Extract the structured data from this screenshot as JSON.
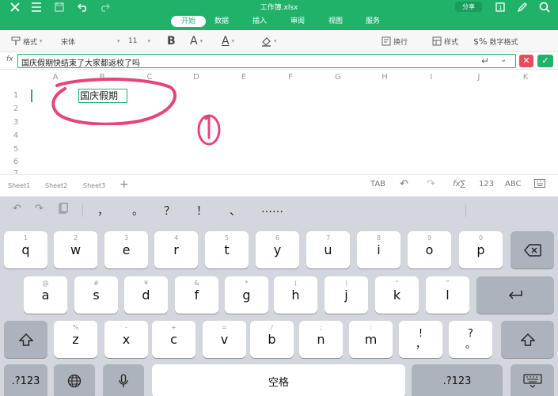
{
  "header": {
    "title": "工作簿.xlsx",
    "share_label": "分享",
    "tabs": [
      "开始",
      "数据",
      "插入",
      "审阅",
      "视图",
      "服务"
    ],
    "active_tab": 0
  },
  "toolbar": {
    "format_label": "格式",
    "font_name": "宋体",
    "font_size": "11",
    "bold_label": "B",
    "font_color_label": "A",
    "text_color_label": "A",
    "wrap_label": "换行",
    "style_label": "样式",
    "number_format_label": "数字格式"
  },
  "formula_bar": {
    "fx_label": "fx",
    "value": "国庆假期快结束了大家都返校了吗",
    "cancel_label": "✕",
    "confirm_label": "✓"
  },
  "grid": {
    "columns": [
      "A",
      "B",
      "C",
      "D",
      "E",
      "F",
      "G",
      "H",
      "I",
      "J",
      "K"
    ],
    "rows": [
      "1",
      "2",
      "3",
      "4",
      "5",
      "6",
      "7"
    ],
    "editing_text": "国庆假期"
  },
  "sheets": [
    "Sheet1",
    "Sheet2",
    "Sheet3"
  ],
  "sheet_add_label": "+",
  "kb_tools": {
    "tab": "TAB",
    "fx": "fx∑",
    "num": "123",
    "abc": "ABC"
  },
  "suggestions": [
    "，",
    "。",
    "？",
    "！",
    "、",
    "……"
  ],
  "keyboard": {
    "row1": [
      {
        "k": "q",
        "h": "1"
      },
      {
        "k": "w",
        "h": "2"
      },
      {
        "k": "e",
        "h": "3"
      },
      {
        "k": "r",
        "h": "4"
      },
      {
        "k": "t",
        "h": "5"
      },
      {
        "k": "y",
        "h": "6"
      },
      {
        "k": "u",
        "h": "7"
      },
      {
        "k": "i",
        "h": "8"
      },
      {
        "k": "o",
        "h": "9"
      },
      {
        "k": "p",
        "h": "0"
      }
    ],
    "row2": [
      {
        "k": "a",
        "h": "@"
      },
      {
        "k": "s",
        "h": "#"
      },
      {
        "k": "d",
        "h": "¥"
      },
      {
        "k": "f",
        "h": "&"
      },
      {
        "k": "g",
        "h": "*"
      },
      {
        "k": "h",
        "h": "("
      },
      {
        "k": "j",
        "h": ")"
      },
      {
        "k": "k",
        "h": "“"
      },
      {
        "k": "l",
        "h": "”"
      }
    ],
    "row3": [
      {
        "k": "z",
        "h": "%"
      },
      {
        "k": "x",
        "h": "-"
      },
      {
        "k": "c",
        "h": "+"
      },
      {
        "k": "v",
        "h": "="
      },
      {
        "k": "b",
        "h": "/"
      },
      {
        "k": "n",
        "h": ";"
      },
      {
        "k": "m",
        "h": ":"
      }
    ],
    "excl_top": "!",
    "excl_bottom": "，",
    "q_top": "?",
    "q_bottom": "。",
    "num_label": ".?123",
    "space_label": "空格",
    "num_label_right": ".?123"
  },
  "colors": {
    "accent": "#21b26a",
    "cancel": "#e84b5b",
    "annotation": "#e6457a"
  }
}
